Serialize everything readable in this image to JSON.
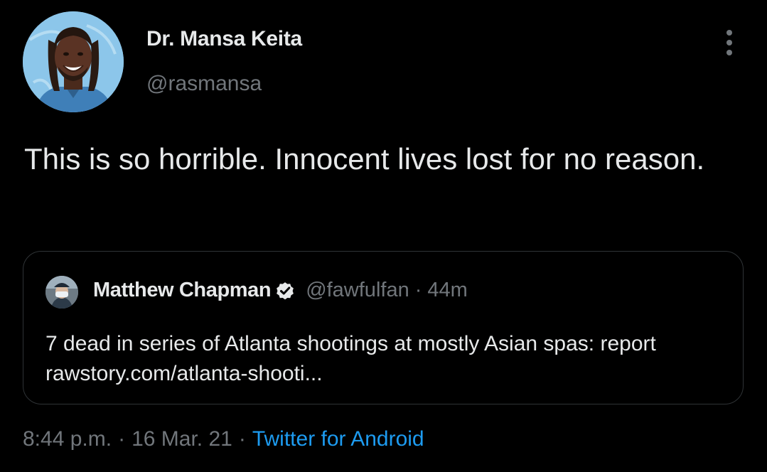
{
  "author": {
    "display_name": "Dr. Mansa Keita",
    "handle": "@rasmansa",
    "avatar_icon": "illustrated-portrait-avatar"
  },
  "more_menu_icon": "vertical-ellipsis-icon",
  "tweet": {
    "text": "This is so horrible. Innocent lives lost for no reason."
  },
  "quoted_tweet": {
    "author_name": "Matthew Chapman",
    "verified_icon": "verified-badge-icon",
    "handle": "@fawfulfan",
    "separator": "·",
    "time_ago": "44m",
    "text": "7 dead in series of Atlanta shootings at mostly Asian spas: report rawstory.com/atlanta-shooti..."
  },
  "meta": {
    "time": "8:44 p.m.",
    "separator": "·",
    "date": "16 Mar. 21",
    "source": "Twitter for Android"
  },
  "colors": {
    "background": "#000000",
    "primary_text": "#e7e9ea",
    "secondary_text": "#71767b",
    "link": "#1d9bf0",
    "border": "#2f3336"
  }
}
